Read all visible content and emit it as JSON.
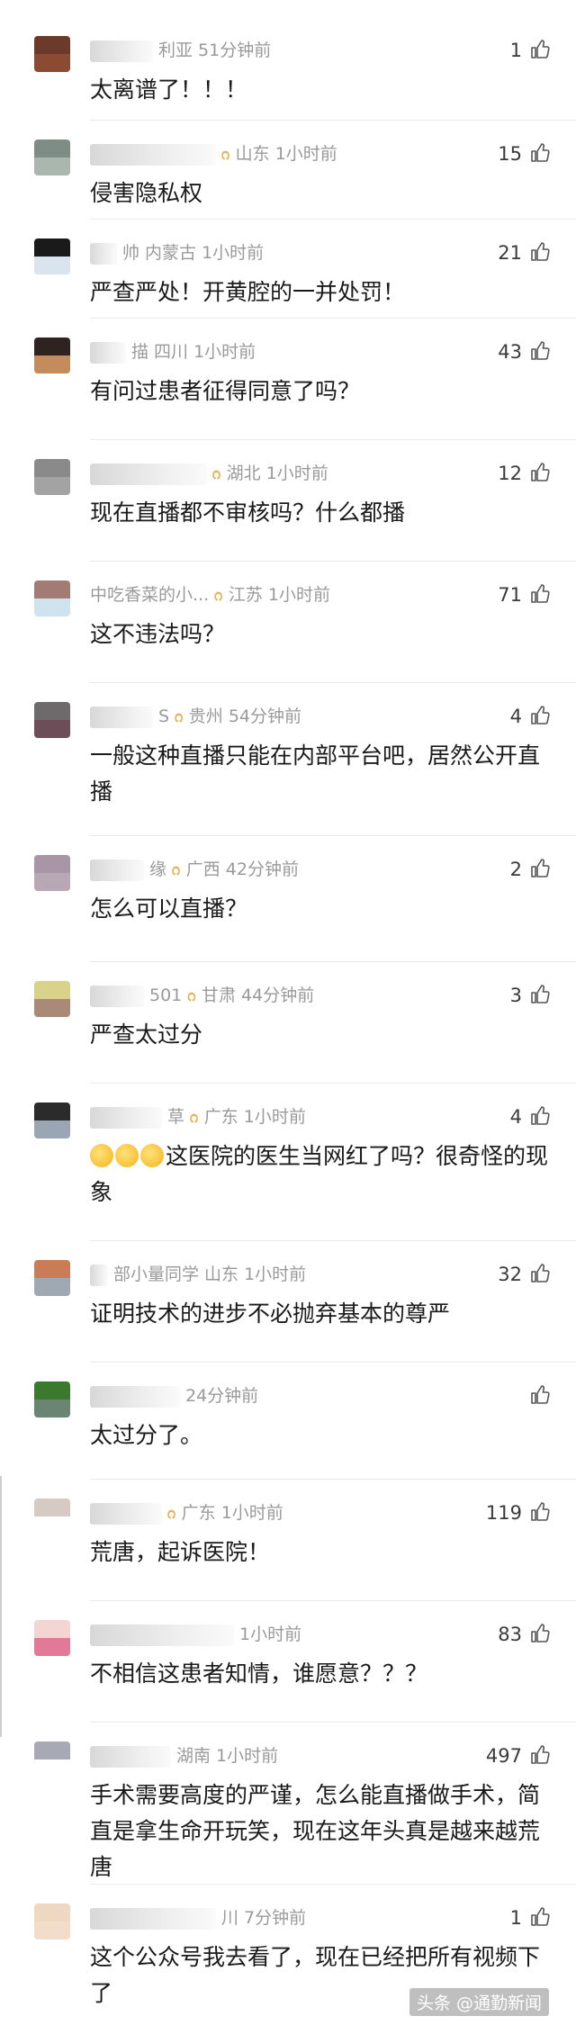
{
  "comments": [
    {
      "name": "利亚",
      "region": "",
      "time": "51分钟前",
      "likes": "1",
      "text": "太离谱了！！！",
      "avatar": [
        "#6b3a2a",
        "#8b4b33"
      ],
      "blur": 70,
      "badge": false
    },
    {
      "name": "",
      "region": "山东",
      "time": "1小时前",
      "likes": "15",
      "text": "侵害隐私权",
      "avatar": [
        "#7d8c84",
        "#a9b7ae"
      ],
      "blur": 140,
      "badge": true
    },
    {
      "name": "帅",
      "region": "内蒙古",
      "time": "1小时前",
      "likes": "21",
      "text": "严查严处！开黄腔的一并处罚！",
      "avatar": [
        "#1b1a1a",
        "#d9e4ef"
      ],
      "blur": 30,
      "badge": false
    },
    {
      "name": "描",
      "region": "四川",
      "time": "1小时前",
      "likes": "43",
      "text": "有问过患者征得同意了吗？",
      "avatar": [
        "#2f2322",
        "#c48c5a"
      ],
      "blur": 40,
      "badge": false
    },
    {
      "name": "",
      "region": "湖北",
      "time": "1小时前",
      "likes": "12",
      "text": "现在直播都不审核吗？什么都播",
      "avatar": [
        "#8a8a8a",
        "#a3a3a3"
      ],
      "blur": 130,
      "badge": true
    },
    {
      "name": "中吃香菜的小...",
      "region": "江苏",
      "time": "1小时前",
      "likes": "71",
      "text": "这不违法吗？",
      "avatar": [
        "#a27b74",
        "#cfe3ee"
      ],
      "blur": 0,
      "badge": true
    },
    {
      "name": "S",
      "region": "贵州",
      "time": "54分钟前",
      "likes": "4",
      "text": "一般这种直播只能在内部平台吧，居然公开直播",
      "avatar": [
        "#6e6a6b",
        "#6d4d58"
      ],
      "blur": 70,
      "badge": true
    },
    {
      "name": "缘",
      "region": "广西",
      "time": "42分钟前",
      "likes": "2",
      "text": "怎么可以直播？",
      "avatar": [
        "#a896a6",
        "#b8a8b6"
      ],
      "blur": 60,
      "badge": true
    },
    {
      "name": "501",
      "region": "甘肃",
      "time": "44分钟前",
      "likes": "3",
      "text": "严查太过分",
      "avatar": [
        "#d9d28a",
        "#a88a76"
      ],
      "blur": 60,
      "badge": true
    },
    {
      "name": "草",
      "region": "广东",
      "time": "1小时前",
      "likes": "4",
      "text": "这医院的医生当网红了吗？很奇怪的现象",
      "avatar": [
        "#2b2b2b",
        "#9aa6b4"
      ],
      "blur": 80,
      "badge": true,
      "emojis": 3
    },
    {
      "name": "部小量同学",
      "region": "山东",
      "time": "1小时前",
      "likes": "32",
      "text": "证明技术的进步不必抛弃基本的尊严",
      "avatar": [
        "#c97c55",
        "#9fa9b3"
      ],
      "blur": 20,
      "badge": false
    },
    {
      "name": "",
      "region": "",
      "time": "24分钟前",
      "likes": "",
      "text": "太过分了。",
      "avatar": [
        "#3b7a2e",
        "#6a8672"
      ],
      "blur": 100,
      "badge": false
    },
    {
      "name": "",
      "region": "广东",
      "time": "1小时前",
      "likes": "119",
      "text": "荒唐，起诉医院！",
      "avatar": [
        "#d7c9c4",
        "#ffffff"
      ],
      "blur": 80,
      "badge": true
    },
    {
      "name": "",
      "region": "",
      "time": "1小时前",
      "likes": "83",
      "text": "不相信这患者知情，谁愿意？？？",
      "avatar": [
        "#f3d5d3",
        "#e27a97"
      ],
      "blur": 160,
      "badge": false
    },
    {
      "name": "",
      "region": "湖南",
      "time": "1小时前",
      "likes": "497",
      "text": "手术需要高度的严谨，怎么能直播做手术，简直是拿生命开玩笑，现在这年头真是越来越荒唐",
      "avatar": [
        "#a7a9b4",
        "#ffffff"
      ],
      "blur": 90,
      "badge": false
    },
    {
      "name": "",
      "region": "川",
      "time": "7分钟前",
      "likes": "1",
      "text": "这个公众号我去看了，现在已经把所有视频下了",
      "avatar": [
        "#efd8c2",
        "#f1ddc9"
      ],
      "blur": 140,
      "badge": false
    }
  ],
  "watermark": "头条 @通勤新闻"
}
